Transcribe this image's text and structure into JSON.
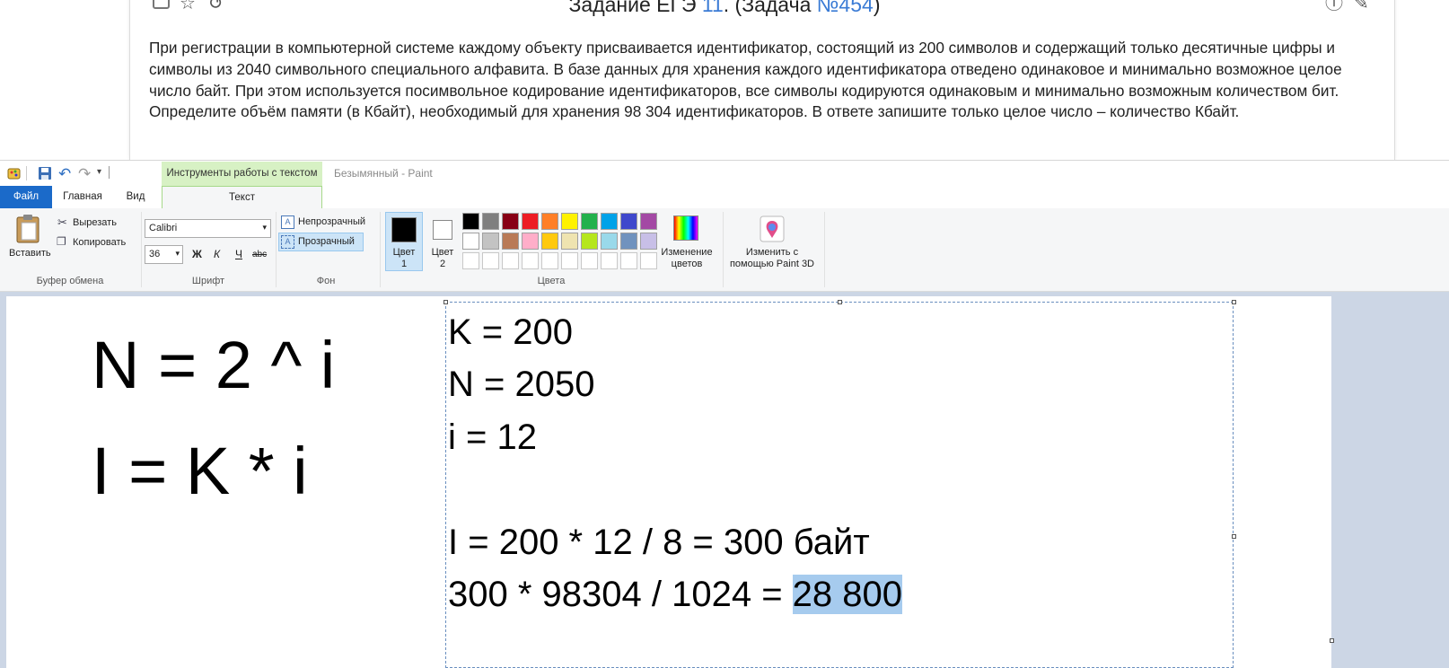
{
  "task": {
    "title_prefix": "Задание ЕГЭ ",
    "title_link1": "11",
    "title_mid": ". (Задача ",
    "title_link2": "№454",
    "title_suffix": ")",
    "text": "При регистрации в компьютерной системе каждому объекту присваивается идентификатор, состоящий из 200 символов и содержащий только десятичные цифры и символы из 2040 символьного специального алфавита. В базе данных для хранения каждого идентификатора отведено одинаковое и минимально возможное целое число байт. При этом используется посимвольное кодирование идентификаторов, все символы кодируются одинаковым и минимально возможным количеством бит. Определите объём памяти (в Кбайт), необходимый для хранения 98 304 идентификаторов. В ответе запишите только целое число – количество Кбайт."
  },
  "paint": {
    "context_tab": "Инструменты работы с текстом",
    "window_title": "Безымянный - Paint",
    "tabs": {
      "file": "Файл",
      "home": "Главная",
      "view": "Вид",
      "text": "Текст"
    },
    "clipboard": {
      "paste": "Вставить",
      "cut": "Вырезать",
      "copy": "Копировать",
      "group": "Буфер обмена"
    },
    "font": {
      "family": "Calibri",
      "size": "36",
      "bold": "Ж",
      "italic": "К",
      "underline": "Ч",
      "strike": "abc",
      "group": "Шрифт"
    },
    "background": {
      "opaque": "Непрозрачный",
      "transparent": "Прозрачный",
      "group": "Фон"
    },
    "colors": {
      "color1_l1": "Цвет",
      "color1_l2": "1",
      "color2_l1": "Цвет",
      "color2_l2": "2",
      "edit_l1": "Изменение",
      "edit_l2": "цветов",
      "group": "Цвета",
      "color1_value": "#000000",
      "color2_value": "#ffffff",
      "row1": [
        "#000000",
        "#7f7f7f",
        "#880015",
        "#ed1c24",
        "#ff7f27",
        "#fff200",
        "#22b14c",
        "#00a2e8",
        "#3f48cc",
        "#a349a4"
      ],
      "row2": [
        "#ffffff",
        "#c3c3c3",
        "#b97a57",
        "#ffaec9",
        "#ffc90e",
        "#efe4b0",
        "#b5e61d",
        "#99d9ea",
        "#7092be",
        "#c8bfe7"
      ],
      "row3": [
        "#ffffff",
        "#ffffff",
        "#ffffff",
        "#ffffff",
        "#ffffff",
        "#ffffff",
        "#ffffff",
        "#ffffff",
        "#ffffff",
        "#ffffff"
      ]
    },
    "paint3d": {
      "l1": "Изменить с",
      "l2": "помощью Paint 3D"
    }
  },
  "canvas": {
    "formula1": "N = 2 ^ i",
    "formula2": "I = K * i",
    "lines": [
      "K = 200",
      "N = 2050",
      "i = 12",
      "I = 200 * 12 / 8 = 300 байт"
    ],
    "last_prefix": "300 * 98304 / 1024 = ",
    "last_highlight": "28 800"
  }
}
